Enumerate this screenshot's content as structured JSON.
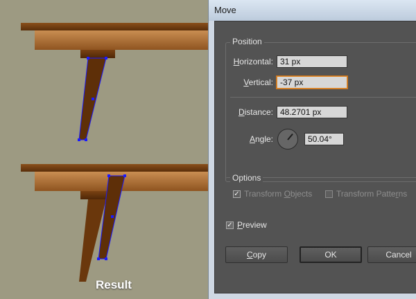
{
  "artwork": {
    "result_label": "Result"
  },
  "dialog": {
    "title": "Move",
    "position_group": {
      "legend": "Position",
      "horizontal_label": "Horizontal:",
      "horizontal_value": "31 px",
      "vertical_label": "Vertical:",
      "vertical_value": "-37 px",
      "distance_label": "Distance:",
      "distance_value": "48.2701 px",
      "angle_label": "Angle:",
      "angle_value": "50.04°"
    },
    "options_group": {
      "legend": "Options",
      "transform_objects": {
        "label": "Transform Objects",
        "checked": true,
        "enabled": false
      },
      "transform_patterns": {
        "label": "Transform Patterns",
        "checked": false,
        "enabled": false
      }
    },
    "preview": {
      "label": "Preview",
      "checked": true
    },
    "buttons": {
      "copy": "Copy",
      "ok": "OK",
      "cancel": "Cancel"
    }
  },
  "colors": {
    "background": "#9d9a82",
    "wood_dark": "#6b3a0f",
    "wood_light": "#c8894a",
    "selection": "#1a1aff",
    "dialog_panel": "#535353"
  }
}
